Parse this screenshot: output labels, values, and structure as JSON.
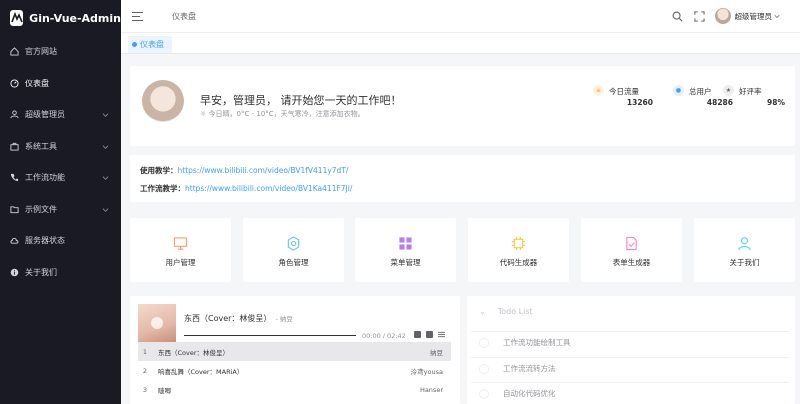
{
  "app": {
    "name": "Gin-Vue-Admin"
  },
  "sidebar": {
    "items": [
      {
        "label": "官方网站",
        "icon": "home-icon"
      },
      {
        "label": "仪表盘",
        "icon": "odometer-icon",
        "active": true
      },
      {
        "label": "超级管理员",
        "icon": "user-icon",
        "expandable": true
      },
      {
        "label": "系统工具",
        "icon": "toolbox-icon",
        "expandable": true
      },
      {
        "label": "工作流功能",
        "icon": "phone-icon",
        "expandable": true
      },
      {
        "label": "示例文件",
        "icon": "folder-icon",
        "expandable": true
      },
      {
        "label": "服务器状态",
        "icon": "cloud-icon"
      },
      {
        "label": "关于我们",
        "icon": "info-icon"
      }
    ]
  },
  "header": {
    "breadcrumb": "仪表盘",
    "user": "超级管理员"
  },
  "tags": [
    {
      "label": "仪表盘",
      "active": true
    }
  ],
  "welcome": {
    "greeting": "早安，管理员， 请开始您一天的工作吧！",
    "weather": "今日晴，0°C - 10°C，天气寒冷，注意添加衣物。",
    "stats": [
      {
        "label": "今日流量",
        "value": "13260",
        "icon": "menu-icon",
        "color": "#ff9c00"
      },
      {
        "label": "总用户",
        "value": "48286",
        "icon": "user-icon",
        "color": "#409eff"
      },
      {
        "label": "好评率",
        "value": "98%",
        "icon": "star-icon",
        "color": "#606266"
      }
    ]
  },
  "links": [
    {
      "label": "使用教学：",
      "url": "https://www.bilibili.com/video/BV1fV411y7dT/"
    },
    {
      "label": "工作流教学：",
      "url": "https://www.bilibili.com/video/BV1Ka411F7Ji/"
    }
  ],
  "quick_entries": [
    {
      "label": "用户管理",
      "icon": "monitor-icon",
      "color": "#ff9c6e"
    },
    {
      "label": "角色管理",
      "icon": "setting-icon",
      "color": "#69c0ff"
    },
    {
      "label": "菜单管理",
      "icon": "menu-grid-icon",
      "color": "#b37feb"
    },
    {
      "label": "代码生成器",
      "icon": "cpu-icon",
      "color": "#ffd666"
    },
    {
      "label": "表单生成器",
      "icon": "document-check-icon",
      "color": "#ff85c0"
    },
    {
      "label": "关于我们",
      "icon": "user-icon",
      "color": "#5cdbd3"
    }
  ],
  "music": {
    "title": "东西（Cover：林俊呈）",
    "artist": "- 纳豆",
    "time": "00:00 / 02:42",
    "playlist": [
      {
        "n": "1",
        "name": "东西（Cover：林俊呈）",
        "artist": "纳豆",
        "selected": true
      },
      {
        "n": "2",
        "name": "响喜乱舞（Cover：MARiA）",
        "artist": "泠鸢yousa"
      },
      {
        "n": "3",
        "name": "啵唧",
        "artist": "Hanser"
      }
    ]
  },
  "todo": {
    "title": "Todo List",
    "items": [
      "工作流功能绘制工具",
      "工作流流转方法",
      "自动化代码优化"
    ]
  }
}
